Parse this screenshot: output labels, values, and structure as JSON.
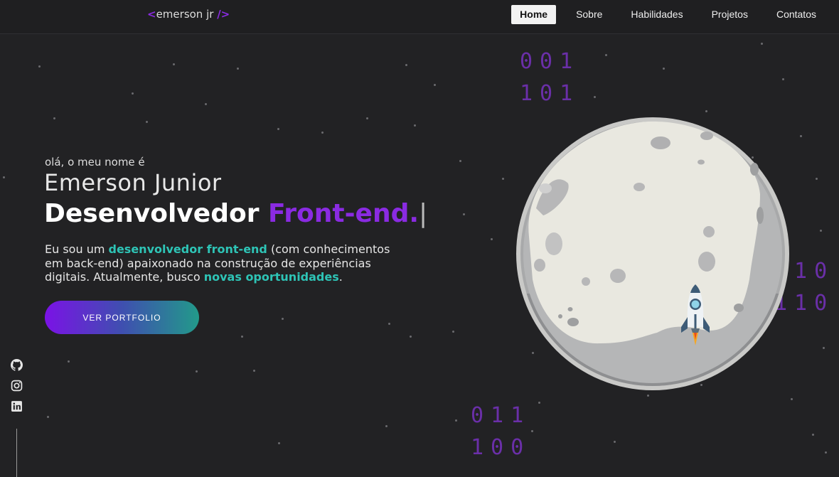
{
  "header": {
    "logo_open": "<",
    "logo_text": "emerson jr",
    "logo_close": "/>",
    "nav": [
      {
        "label": "Home",
        "active": true
      },
      {
        "label": "Sobre",
        "active": false
      },
      {
        "label": "Habilidades",
        "active": false
      },
      {
        "label": "Projetos",
        "active": false
      },
      {
        "label": "Contatos",
        "active": false
      }
    ]
  },
  "hero": {
    "greeting": "olá, o meu nome é",
    "name": "Emerson Junior",
    "role_prefix": "Desenvolvedor ",
    "role_accent": "Front-end.",
    "role_cursor": "|",
    "desc_1": "Eu sou um ",
    "desc_hl_1": "desenvolvedor front-end",
    "desc_2": " (com conhecimentos em back-end) apaixonado na construção de experiências digitais. Atualmente, busco ",
    "desc_hl_2": "novas oportunidades",
    "desc_3": ".",
    "button_label": "VER PORTFOLIO"
  },
  "binary": {
    "top": [
      "001",
      "101"
    ],
    "right": [
      "010",
      "110"
    ],
    "bottom": [
      "011",
      "100"
    ]
  },
  "social": [
    "github-icon",
    "instagram-icon",
    "linkedin-icon"
  ],
  "colors": {
    "background": "#222224",
    "accent_purple": "#8a2be2",
    "accent_teal": "#2ec4b6"
  }
}
